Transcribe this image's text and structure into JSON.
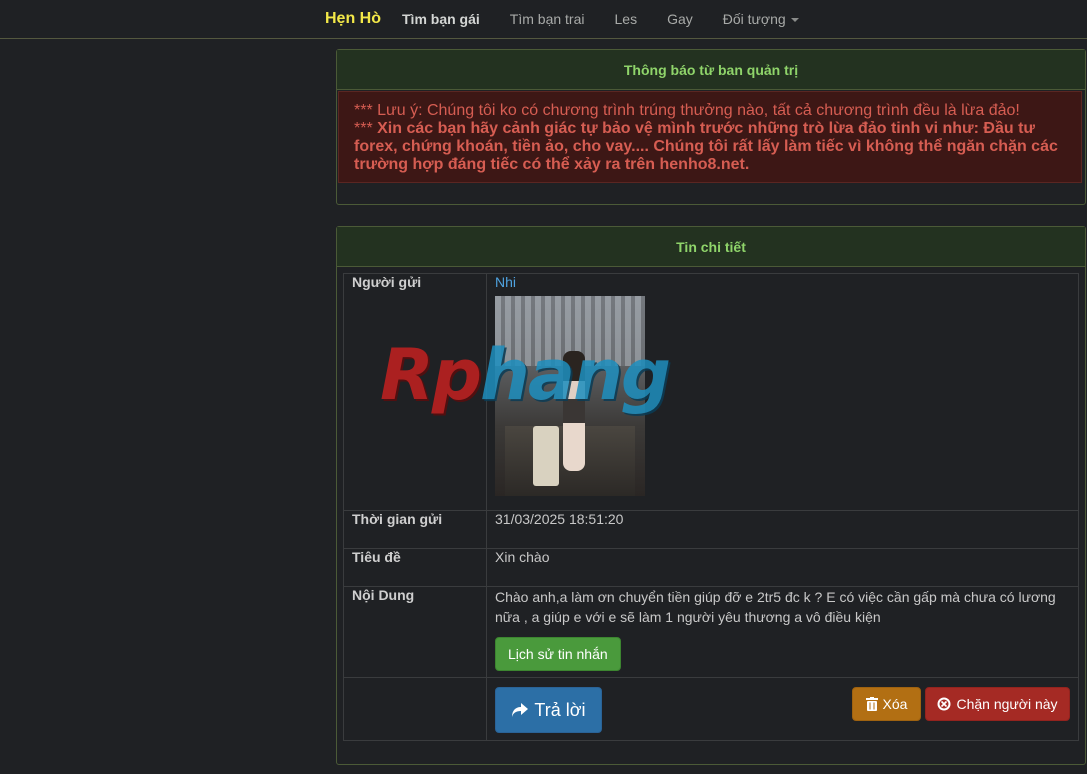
{
  "navbar": {
    "brand": "Hẹn Hò",
    "items": [
      {
        "label": "Tìm bạn gái"
      },
      {
        "label": "Tìm bạn trai"
      },
      {
        "label": "Les"
      },
      {
        "label": "Gay"
      },
      {
        "label": "Đối tượng"
      }
    ]
  },
  "notice": {
    "title": "Thông báo từ ban quản trị",
    "line1": "*** Lưu ý: Chúng tôi ko có chương trình trúng thưởng nào, tất cả chương trình đều là lừa đảo!",
    "line2_prefix": "*** ",
    "line2_bold": "Xin các bạn hãy cảnh giác tự bảo vệ mình trước những trò lừa đảo tinh vi như: Đầu tư forex, chứng khoán, tiền ảo, cho vay.... Chúng tôi rất lấy làm tiếc vì không thể ngăn chặn các trường hợp đáng tiếc có thể xảy ra trên henho8.net."
  },
  "detail": {
    "title": "Tin chi tiết",
    "sender_label": "Người gửi",
    "sender_name": "Nhi",
    "time_label": "Thời gian gửi",
    "time_value": "31/03/2025 18:51:20",
    "subject_label": "Tiêu đề",
    "subject_value": "Xin chào",
    "content_label": "Nội Dung",
    "content_value": "Chào anh,a làm ơn chuyển tiền giúp đỡ e 2tr5 đc k ? E có việc cần gấp mà chưa có lương nữa , a giúp e với e sẽ làm 1 người yêu thương a vô điều kiện",
    "history_button": "Lịch sử tin nhắn",
    "reply_button": "Trả lời",
    "delete_button": "Xóa",
    "block_button": "Chặn người này"
  },
  "watermark": {
    "part1": "Rp",
    "part2": "hang"
  },
  "icons": {
    "caret": "caret-down-icon",
    "reply": "share-arrow-icon",
    "delete": "trash-icon",
    "block": "ban-circle-icon"
  },
  "colors": {
    "brand": "#f3e848",
    "panel_heading_text": "#8fd46a",
    "alert_text": "#d65d52",
    "link": "#4fa3e0",
    "btn_success": "#4a9a3c",
    "btn_primary": "#2c6fa6",
    "btn_warning": "#b26f13",
    "btn_danger": "#a52a24"
  }
}
